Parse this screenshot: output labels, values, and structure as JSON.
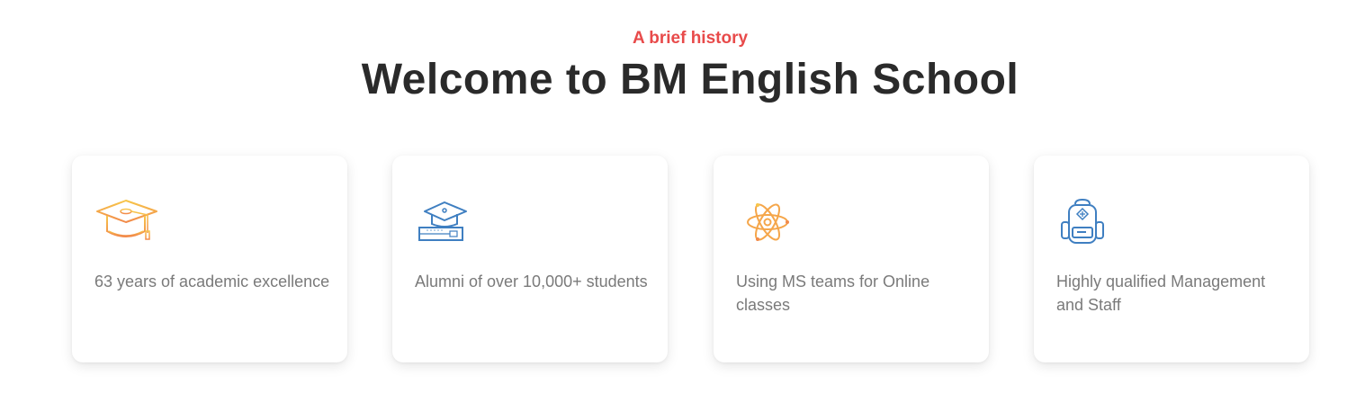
{
  "header": {
    "eyebrow": "A brief history",
    "title": "Welcome to BM English School"
  },
  "cards": [
    {
      "icon": "graduation-cap-icon",
      "text": "63 years of academic excellence"
    },
    {
      "icon": "graduate-school-icon",
      "text": "Alumni of over 10,000+ students"
    },
    {
      "icon": "atom-icon",
      "text": "Using MS teams for Online classes"
    },
    {
      "icon": "backpack-icon",
      "text": "Highly qualified Management and Staff"
    }
  ],
  "colors": {
    "accent": "#e84a4a",
    "title": "#2a2a2a",
    "body_text": "#7a7a7a",
    "icon_orange": "#f5a64a",
    "icon_blue": "#3f7fc1"
  }
}
